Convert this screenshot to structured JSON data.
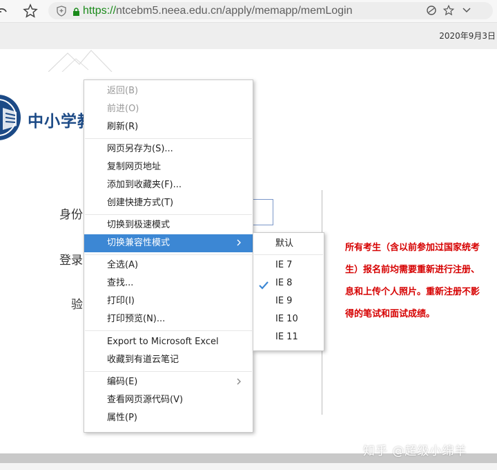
{
  "browser": {
    "url_protocol": "https://",
    "url_host": "ntcebm5.neea.edu.cn",
    "url_path": "/apply/memapp/memLogin",
    "icons": [
      "back-icon",
      "star-icon",
      "shield-icon",
      "lock-icon",
      "reader-icon",
      "star-outline-icon",
      "chevron-down-icon"
    ]
  },
  "page": {
    "date": "2020年9月3日",
    "logo_text": "中小学教",
    "labels": {
      "id": "身份",
      "login": "登录",
      "verify": "验"
    },
    "notice_lines": [
      "所有考生（含以前参加过国家统考",
      "生）报名前均需要重新进行注册、",
      "息和上传个人照片。重新注册不影",
      "得的笔试和面试成绩。"
    ],
    "watermark": "知乎 @超级小绵羊",
    "notice_color": "#d60000"
  },
  "context_menu": {
    "items": [
      "返回(B)",
      "前进(O)",
      "刷新(R)",
      "网页另存为(S)...",
      "复制网页地址",
      "添加到收藏夹(F)...",
      "创建快捷方式(T)",
      "切换到极速模式",
      "切换兼容性模式",
      "全选(A)",
      "查找...",
      "打印(I)",
      "打印预览(N)...",
      "Export to Microsoft Excel",
      "收藏到有道云笔记",
      "编码(E)",
      "查看网页源代码(V)",
      "属性(P)"
    ],
    "highlight_color": "#3c87d4"
  },
  "submenu": {
    "items": [
      "默认",
      "IE 7",
      "IE 8",
      "IE 9",
      "IE 10",
      "IE 11"
    ],
    "checked": "IE 8"
  }
}
